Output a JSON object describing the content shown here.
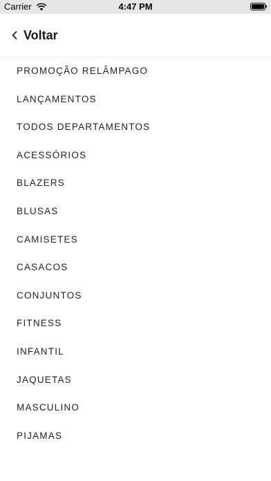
{
  "status_bar": {
    "carrier": "Carrier",
    "time": "4:47 PM",
    "icons": [
      "wifi-icon",
      "battery-icon"
    ]
  },
  "nav": {
    "back_label": "Voltar",
    "back_icon": "chevron-left-icon"
  },
  "menu": {
    "items": [
      "PROMOÇÃO RELÂMPAGO",
      "LANÇAMENTOS",
      "TODOS DEPARTAMENTOS",
      "ACESSÓRIOS",
      "BLAZERS",
      "BLUSAS",
      "CAMISETES",
      "CASACOS",
      "CONJUNTOS",
      "FITNESS",
      "INFANTIL",
      "JAQUETAS",
      "MASCULINO",
      "PIJAMAS"
    ]
  },
  "colors": {
    "status_bar_bg": "#e6e6e6",
    "text": "#1a1a1a",
    "divider": "#ececec"
  }
}
